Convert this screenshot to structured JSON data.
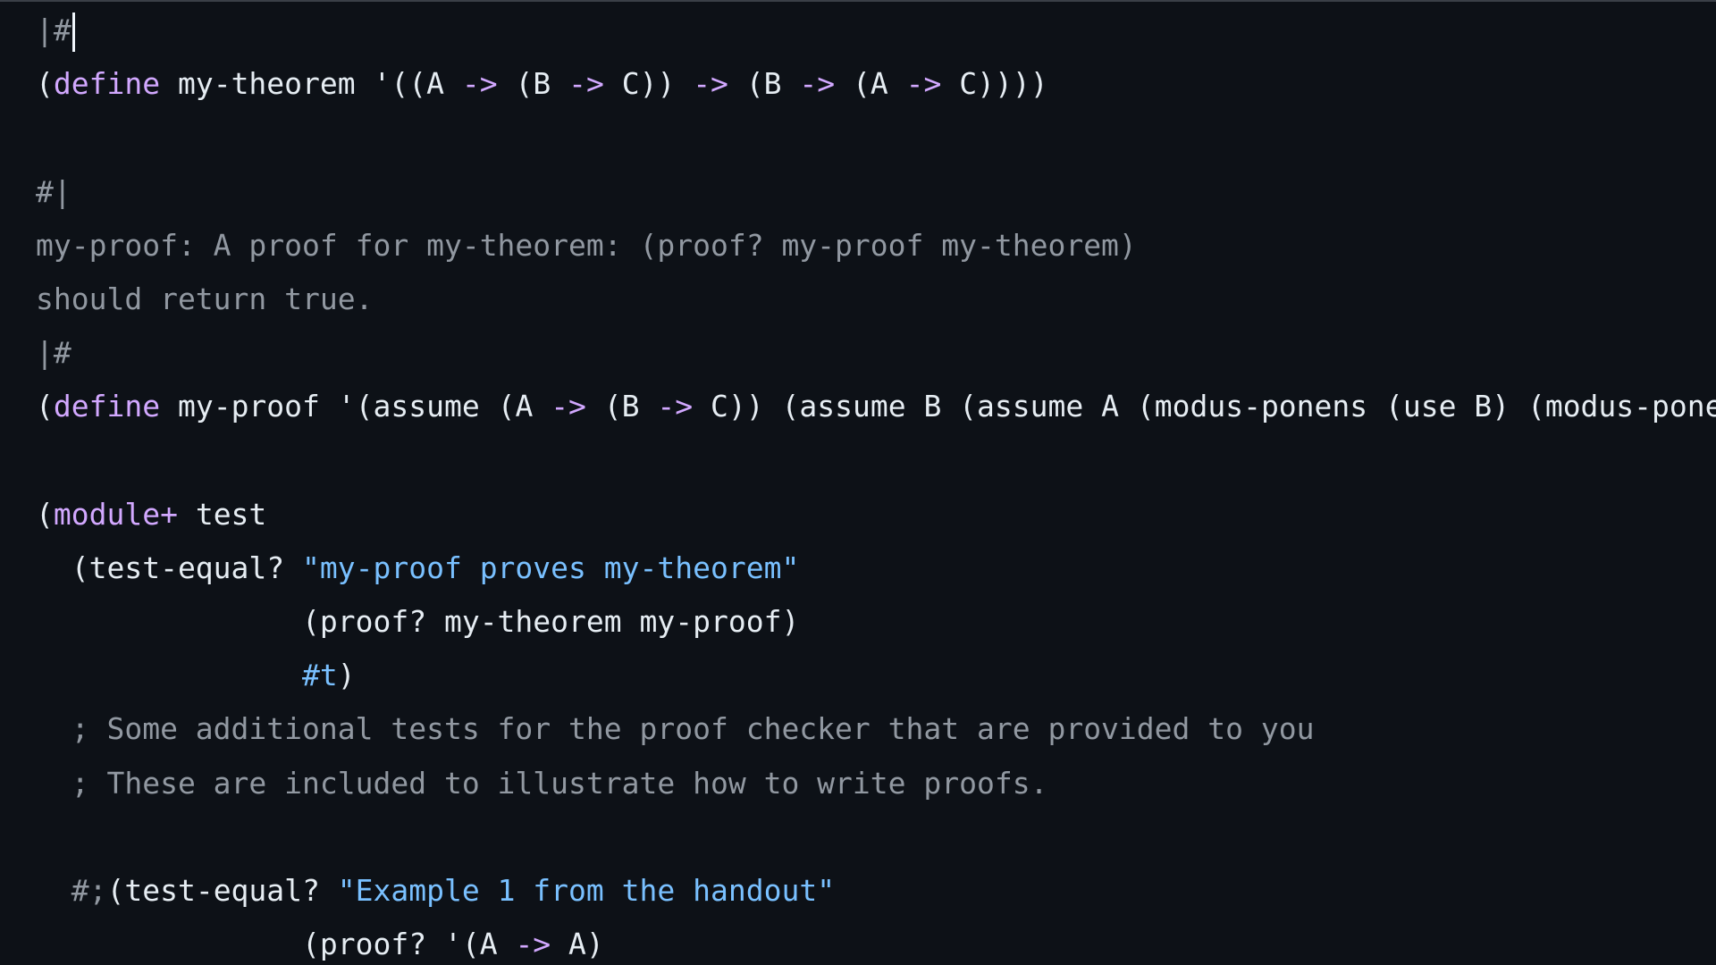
{
  "editor": {
    "lines": [
      {
        "tokens": [
          {
            "t": "|#",
            "c": "comment"
          }
        ],
        "cursor": true
      },
      {
        "tokens": [
          {
            "t": "(",
            "c": "plain"
          },
          {
            "t": "define",
            "c": "kw"
          },
          {
            "t": " my-theorem '((A ",
            "c": "plain"
          },
          {
            "t": "->",
            "c": "op"
          },
          {
            "t": " (B ",
            "c": "plain"
          },
          {
            "t": "->",
            "c": "op"
          },
          {
            "t": " C)) ",
            "c": "plain"
          },
          {
            "t": "->",
            "c": "op"
          },
          {
            "t": " (B ",
            "c": "plain"
          },
          {
            "t": "->",
            "c": "op"
          },
          {
            "t": " (A ",
            "c": "plain"
          },
          {
            "t": "->",
            "c": "op"
          },
          {
            "t": " C))))",
            "c": "plain"
          }
        ]
      },
      {
        "tokens": []
      },
      {
        "tokens": [
          {
            "t": "#|",
            "c": "comment"
          }
        ]
      },
      {
        "tokens": [
          {
            "t": "my-proof: A proof for my-theorem: (proof? my-proof my-theorem)",
            "c": "comment"
          }
        ]
      },
      {
        "tokens": [
          {
            "t": "should return true.",
            "c": "comment"
          }
        ]
      },
      {
        "tokens": [
          {
            "t": "|#",
            "c": "comment"
          }
        ]
      },
      {
        "tokens": [
          {
            "t": "(",
            "c": "plain"
          },
          {
            "t": "define",
            "c": "kw"
          },
          {
            "t": " my-proof '(assume (A ",
            "c": "plain"
          },
          {
            "t": "->",
            "c": "op"
          },
          {
            "t": " (B ",
            "c": "plain"
          },
          {
            "t": "->",
            "c": "op"
          },
          {
            "t": " C)) (assume B (assume A (modus-ponens (use B) (modus-ponens (use A) (use (A -> (B -> C)))))))",
            "c": "plain"
          }
        ]
      },
      {
        "tokens": []
      },
      {
        "tokens": [
          {
            "t": "(",
            "c": "plain"
          },
          {
            "t": "module+",
            "c": "kw"
          },
          {
            "t": " test",
            "c": "plain"
          }
        ]
      },
      {
        "tokens": [
          {
            "t": "  (test-equal? ",
            "c": "plain"
          },
          {
            "t": "\"my-proof proves my-theorem\"",
            "c": "str"
          }
        ]
      },
      {
        "tokens": [
          {
            "t": "               (proof? my-theorem my-proof)",
            "c": "plain"
          }
        ]
      },
      {
        "tokens": [
          {
            "t": "               ",
            "c": "plain"
          },
          {
            "t": "#t",
            "c": "lit"
          },
          {
            "t": ")",
            "c": "plain"
          }
        ]
      },
      {
        "tokens": [
          {
            "t": "  ; Some additional tests for the proof checker that are provided to you",
            "c": "comment"
          }
        ]
      },
      {
        "tokens": [
          {
            "t": "  ; These are included to illustrate how to write proofs.",
            "c": "comment"
          }
        ]
      },
      {
        "tokens": []
      },
      {
        "tokens": [
          {
            "t": "  #;",
            "c": "comment"
          },
          {
            "t": "(test-equal? ",
            "c": "plain"
          },
          {
            "t": "\"Example 1 from the handout\"",
            "c": "str"
          }
        ]
      },
      {
        "tokens": [
          {
            "t": "               (proof? '(A ",
            "c": "plain"
          },
          {
            "t": "->",
            "c": "op"
          },
          {
            "t": " A)",
            "c": "plain"
          }
        ]
      }
    ]
  },
  "colors": {
    "background": "#0d1117",
    "text": "#e6edf3",
    "keyword": "#d2a8ff",
    "string": "#79c0ff",
    "comment": "#9198a1"
  }
}
